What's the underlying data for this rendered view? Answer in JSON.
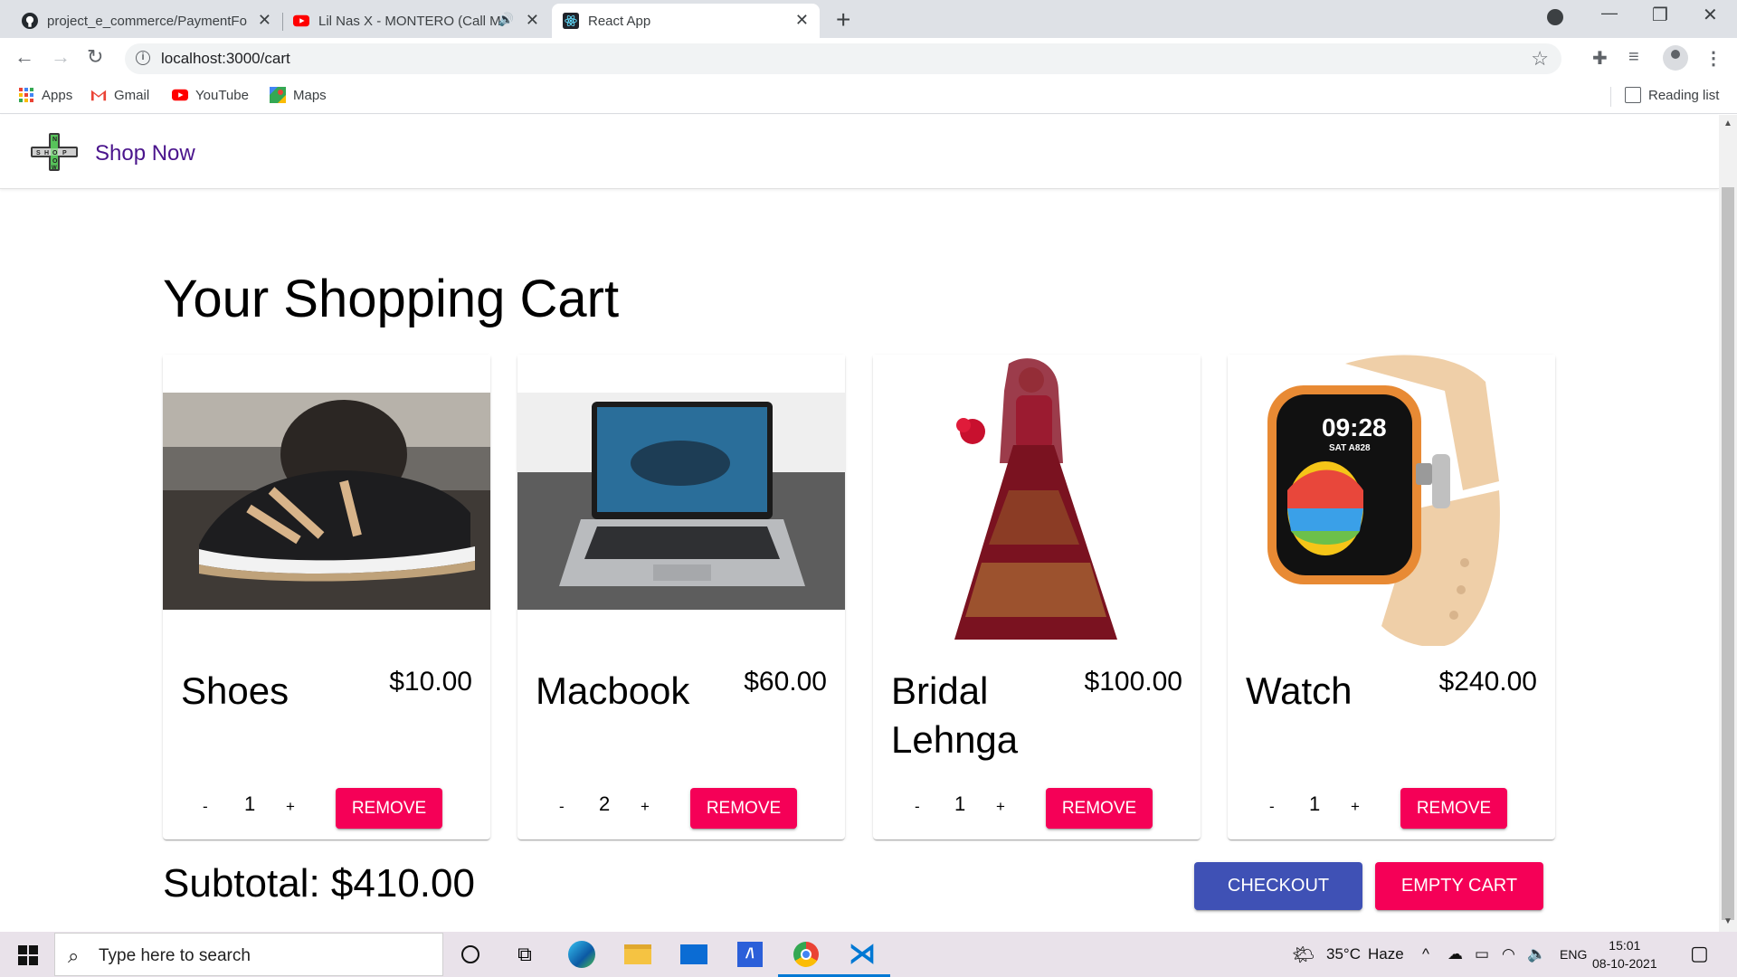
{
  "browser": {
    "tabs": [
      {
        "title": "project_e_commerce/PaymentFo",
        "icon": "github-icon"
      },
      {
        "title": "Lil Nas X - MONTERO (Call M",
        "icon": "youtube-icon"
      },
      {
        "title": "React App",
        "icon": "react-icon"
      }
    ],
    "url": "localhost:3000/cart",
    "bookmarks": [
      {
        "label": "Apps",
        "icon": "apps-grid-icon"
      },
      {
        "label": "Gmail",
        "icon": "gmail-icon"
      },
      {
        "label": "YouTube",
        "icon": "youtube-icon"
      },
      {
        "label": "Maps",
        "icon": "maps-icon"
      }
    ],
    "reading_list": "Reading list"
  },
  "app": {
    "brand": "Shop Now",
    "logo_letters": [
      "S",
      "H",
      "O",
      "P",
      "N",
      "O",
      "W"
    ],
    "cart_title": "Your Shopping Cart",
    "items": [
      {
        "name": "Shoes",
        "price": "$10.00",
        "qty": "1",
        "minus": "-",
        "plus": "+",
        "remove": "REMOVE",
        "image": "running-shoe-photo"
      },
      {
        "name": "Macbook",
        "price": "$60.00",
        "qty": "2",
        "minus": "-",
        "plus": "+",
        "remove": "REMOVE",
        "image": "laptop-photo"
      },
      {
        "name": "Bridal Lehnga",
        "price": "$100.00",
        "qty": "1",
        "minus": "-",
        "plus": "+",
        "remove": "REMOVE",
        "image": "bridal-dress-photo"
      },
      {
        "name": "Watch",
        "price": "$240.00",
        "qty": "1",
        "minus": "-",
        "plus": "+",
        "remove": "REMOVE",
        "image": "smartwatch-photo",
        "watch_time": "09:28",
        "watch_date": "SAT A828"
      }
    ],
    "subtotal": "Subtotal: $410.00",
    "checkout": "CHECKOUT",
    "empty_cart": "EMPTY CART",
    "colors": {
      "primary": "#3f51b5",
      "secondary": "#f50057",
      "brand": "#4a148c"
    }
  },
  "taskbar": {
    "search_placeholder": "Type here to search",
    "weather_temp": "35°C",
    "weather_desc": "Haze",
    "language": "ENG",
    "time": "15:01",
    "date": "08-10-2021"
  }
}
